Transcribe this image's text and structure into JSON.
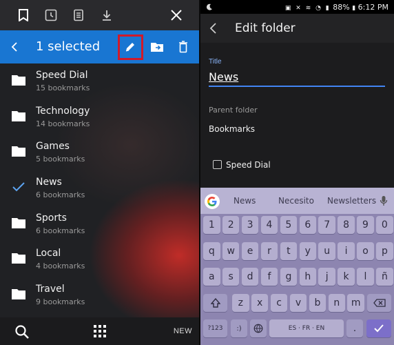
{
  "left": {
    "tabs": [
      "bookmark-icon",
      "history-icon",
      "reading-list-icon",
      "download-icon",
      "close-icon"
    ],
    "selection": {
      "title": "1 selected"
    },
    "bookmarks": [
      {
        "name": "Speed Dial",
        "count": "15 bookmarks",
        "icon": "folder-icon"
      },
      {
        "name": "Technology",
        "count": "14 bookmarks",
        "icon": "folder-icon"
      },
      {
        "name": "Games",
        "count": "5 bookmarks",
        "icon": "folder-icon"
      },
      {
        "name": "News",
        "count": "6 bookmarks",
        "icon": "check-icon"
      },
      {
        "name": "Sports",
        "count": "6 bookmarks",
        "icon": "folder-icon"
      },
      {
        "name": "Local",
        "count": "4 bookmarks",
        "icon": "folder-icon"
      },
      {
        "name": "Travel",
        "count": "9 bookmarks",
        "icon": "folder-icon"
      }
    ],
    "bottom": {
      "new_label": "NEW"
    }
  },
  "right": {
    "status": {
      "battery": "88%",
      "time": "6:12 PM"
    },
    "header": {
      "title": "Edit folder"
    },
    "title_field": {
      "label": "Title",
      "value": "News"
    },
    "parent": {
      "label": "Parent folder",
      "value": "Bookmarks"
    },
    "checkbox": {
      "label": "Speed Dial",
      "checked": false
    },
    "keyboard": {
      "suggestions": [
        "News",
        "Necesito",
        "Newsletters"
      ],
      "row_numbers": [
        "1",
        "2",
        "3",
        "4",
        "5",
        "6",
        "7",
        "8",
        "9",
        "0"
      ],
      "row1": [
        "q",
        "w",
        "e",
        "r",
        "t",
        "y",
        "u",
        "i",
        "o",
        "p"
      ],
      "row2": [
        "a",
        "s",
        "d",
        "f",
        "g",
        "h",
        "j",
        "k",
        "l",
        "ñ"
      ],
      "row3": [
        "z",
        "x",
        "c",
        "v",
        "b",
        "n",
        "m"
      ],
      "symbols_key": "?123",
      "emoji_key": ":)",
      "comma_key": ",",
      "space_key": "ES · FR · EN",
      "period_key": "."
    }
  },
  "colors": {
    "accent": "#1976d2",
    "highlight": "#d01a2a",
    "keyboard": "#8d85b0"
  }
}
